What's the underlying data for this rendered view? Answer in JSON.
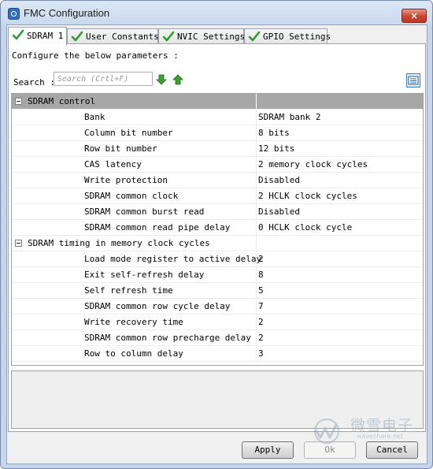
{
  "window": {
    "title": "FMC Configuration",
    "close_label": "×"
  },
  "tabs": [
    {
      "label": "SDRAM 1",
      "active": true
    },
    {
      "label": "User Constants",
      "active": false
    },
    {
      "label": "NVIC Settings",
      "active": false
    },
    {
      "label": "GPIO Settings",
      "active": false
    }
  ],
  "panel": {
    "configure_label": "Configure the below parameters :",
    "search_label": "Search :",
    "search_placeholder": "Search (Crtl+F)",
    "search_value": ""
  },
  "table": {
    "groups": [
      {
        "title": "SDRAM control",
        "rows": [
          {
            "name": "Bank",
            "value": "SDRAM bank 2"
          },
          {
            "name": "Column bit number",
            "value": "8 bits"
          },
          {
            "name": "Row bit number",
            "value": "12 bits"
          },
          {
            "name": "CAS latency",
            "value": "2 memory clock cycles"
          },
          {
            "name": "Write protection",
            "value": "Disabled"
          },
          {
            "name": "SDRAM common clock",
            "value": "2 HCLK clock cycles"
          },
          {
            "name": "SDRAM common burst read",
            "value": "Disabled"
          },
          {
            "name": "SDRAM common read pipe delay",
            "value": "0 HCLK clock cycle"
          }
        ]
      },
      {
        "title": "SDRAM timing in memory clock cycles",
        "rows": [
          {
            "name": "Load mode register to active delay",
            "value": "2"
          },
          {
            "name": "Exit self-refresh delay",
            "value": "8"
          },
          {
            "name": "Self refresh time",
            "value": "5"
          },
          {
            "name": "SDRAM common row cycle delay",
            "value": "7"
          },
          {
            "name": "Write recovery time",
            "value": "2"
          },
          {
            "name": "SDRAM common row precharge delay",
            "value": "2"
          },
          {
            "name": "Row to column delay",
            "value": "3"
          }
        ]
      }
    ]
  },
  "buttons": {
    "apply": "Apply",
    "ok": "Ok",
    "cancel": "Cancel"
  },
  "watermark": {
    "text": "微雪电子",
    "sub": "waveshare.net"
  },
  "colors": {
    "check_green": "#2e9a2e",
    "arrow_green": "#3aa12f",
    "group_header_bg": "#a7a7a7"
  },
  "icons": {
    "tab_status": "check-icon",
    "expand_down": "arrow-down-icon",
    "collapse_up": "arrow-up-icon",
    "view": "list-view-icon",
    "group_toggle": "collapse-minus-icon"
  }
}
